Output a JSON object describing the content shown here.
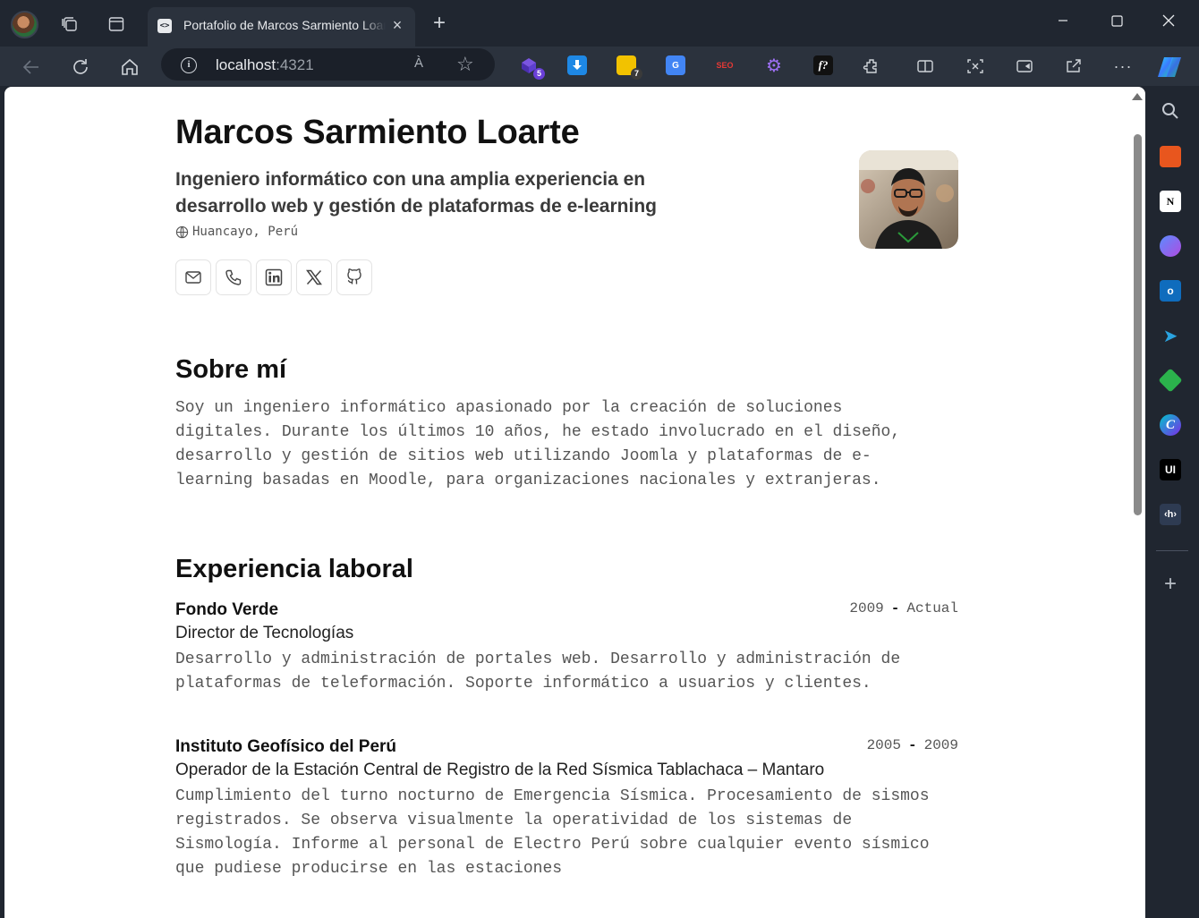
{
  "browser": {
    "tab_title": "Portafolio de Marcos Sarmiento Loarte",
    "favicon_text": "<>",
    "url_host": "localhost",
    "url_port": ":4321",
    "read_aloud_icon": "À",
    "extensions": [
      {
        "name": "ext-purple-cube",
        "color": "#5b3cc4",
        "badge": "5",
        "badge_color": "#6a3fd8"
      },
      {
        "name": "ext-download",
        "color": "#1e88e5",
        "badge": "",
        "badge_color": ""
      },
      {
        "name": "ext-notes",
        "color": "#f2c200",
        "badge": "7",
        "badge_color": "#3a3a3a"
      },
      {
        "name": "ext-google-translate",
        "color": "#4285f4",
        "badge": "",
        "badge_color": ""
      },
      {
        "name": "ext-seo",
        "color": "#c62828",
        "badge": "",
        "badge_color": "",
        "text": "SEO"
      },
      {
        "name": "ext-gear",
        "color": "#7e57c2",
        "badge": "",
        "badge_color": ""
      },
      {
        "name": "ext-fonts",
        "color": "#111111",
        "badge": "",
        "badge_color": "",
        "text": "f?"
      }
    ]
  },
  "profile": {
    "name": "Marcos Sarmiento Loarte",
    "tagline": "Ingeniero informático con una amplia experiencia en desarrollo web y gestión de plataformas de e-learning",
    "location": "Huancayo, Perú"
  },
  "about": {
    "heading": "Sobre mí",
    "text": "Soy un ingeniero informático apasionado por la creación de soluciones digitales. Durante los últimos 10 años, he estado involucrado en el diseño, desarrollo y gestión de sitios web utilizando Joomla y plataformas de e-learning basadas en Moodle, para organizaciones nacionales y extranjeras."
  },
  "experience": {
    "heading": "Experiencia laboral",
    "jobs": [
      {
        "company": "Fondo Verde",
        "start": "2009",
        "end": "Actual",
        "role": "Director de Tecnologías",
        "description": "Desarrollo y administración de portales web. Desarrollo y administración de plataformas de teleformación. Soporte informático a usuarios y clientes."
      },
      {
        "company": "Instituto Geofísico del Perú",
        "start": "2005",
        "end": "2009",
        "role": "Operador de la Estación Central de Registro de la Red Sísmica Tablachaca – Mantaro",
        "description": "Cumplimiento del turno nocturno de Emergencia Sísmica. Procesamiento de sismos registrados. Se observa visualmente la operatividad de los sistemas de Sismología. Informe al personal de Electro Perú sobre cualquier evento sísmico que pudiese producirse en las estaciones"
      }
    ]
  },
  "sidebar_tools": [
    "search",
    "briefcase",
    "notion",
    "copilot-designer",
    "outlook",
    "telegram",
    "feedly",
    "canva",
    "ui",
    "hackmd"
  ]
}
